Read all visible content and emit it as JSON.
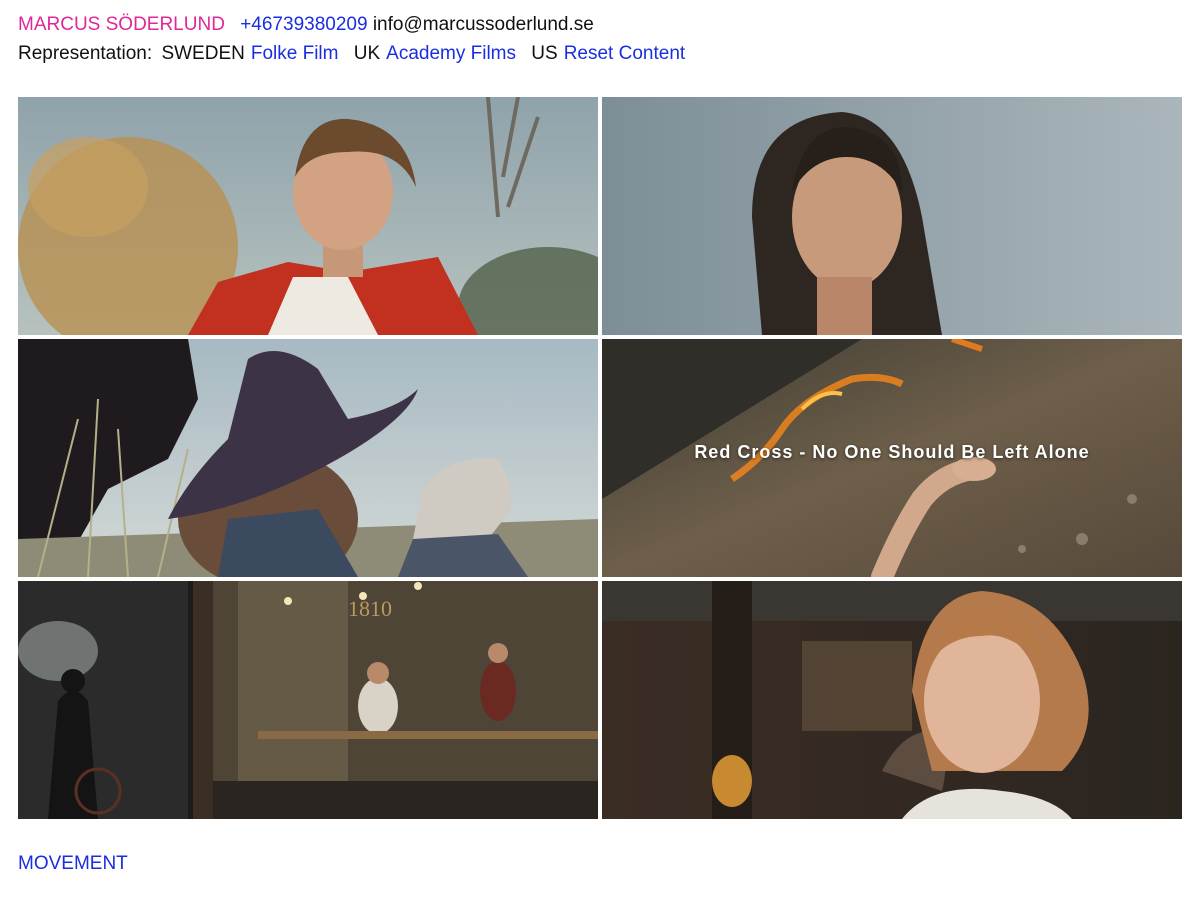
{
  "header": {
    "name": "MARCUS SÖDERLUND",
    "phone": "+46739380209",
    "email": "info@marcussoderlund.se",
    "representation_label": "Representation:",
    "reps": [
      {
        "region": "SWEDEN",
        "agency": "Folke Film"
      },
      {
        "region": "UK",
        "agency": "Academy Films"
      },
      {
        "region": "US",
        "agency": "Reset Content"
      }
    ]
  },
  "tiles": [
    {
      "caption": ""
    },
    {
      "caption": ""
    },
    {
      "caption": ""
    },
    {
      "caption": "Red Cross - No One Should Be Left Alone"
    },
    {
      "caption": ""
    },
    {
      "caption": ""
    }
  ],
  "footer": {
    "link": "MOVEMENT"
  },
  "colors": {
    "name": "#e0279a",
    "link": "#1a2ee0",
    "text": "#111111"
  }
}
